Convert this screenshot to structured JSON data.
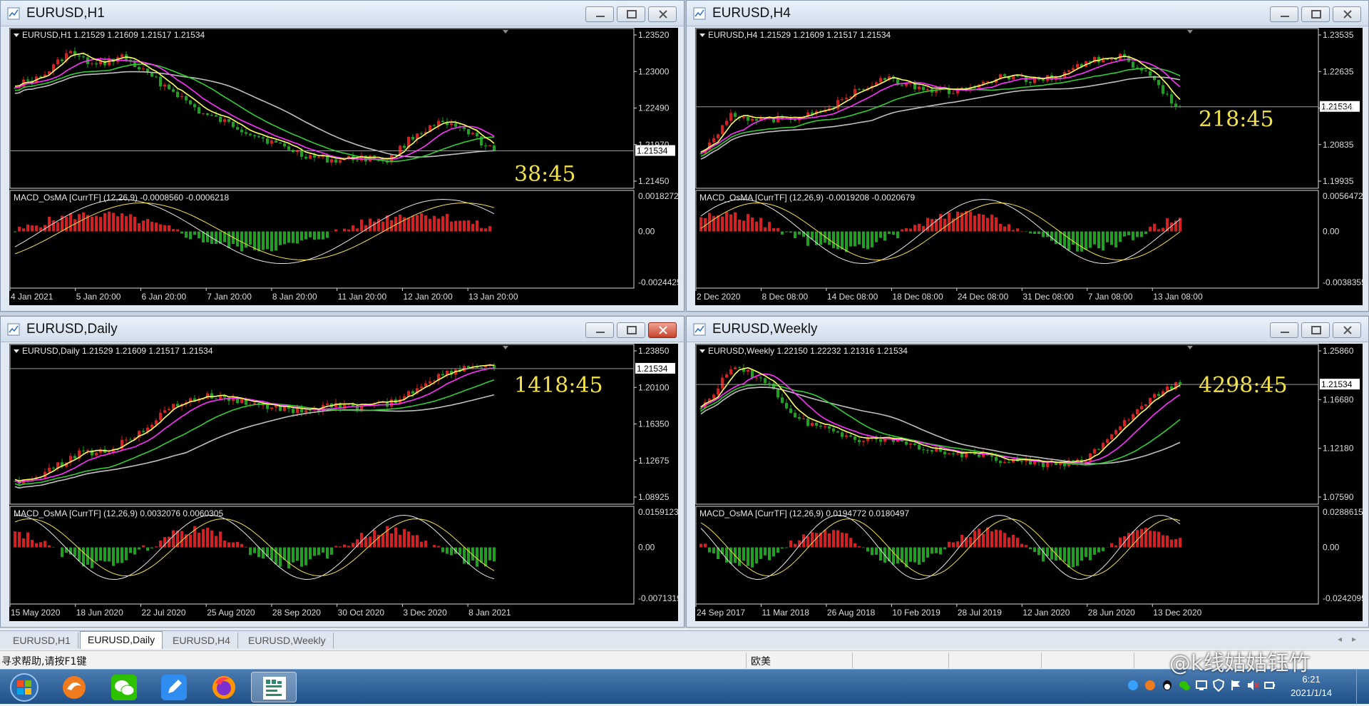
{
  "windows": [
    {
      "id": "h1",
      "title": "EURUSD,H1",
      "ohlc": "EURUSD,H1  1.21529 1.21609 1.21517 1.21534",
      "price_scale": [
        "1.23520",
        "1.23000",
        "1.22490",
        "1.21970",
        "1.21534",
        "1.21450"
      ],
      "current_price": "1.21534",
      "timer": "38:45",
      "macd_label": "MACD_OsMA [CurrTF] (12,26,9) -0.0008560 -0.0006218",
      "macd_scale": [
        "0.0018272",
        "0.00",
        "-0.0024425"
      ],
      "dates": [
        "4 Jan 2021",
        "5 Jan 20:00",
        "6 Jan 20:00",
        "7 Jan 20:00",
        "8 Jan 20:00",
        "11 Jan 20:00",
        "12 Jan 20:00",
        "13 Jan 20:00"
      ],
      "buttons": {
        "close_style": "normal"
      }
    },
    {
      "id": "h4",
      "title": "EURUSD,H4",
      "ohlc": "EURUSD,H4  1.21529 1.21609 1.21517 1.21534",
      "price_scale": [
        "1.23535",
        "1.22635",
        "1.21735",
        "1.21534",
        "1.20835",
        "1.19935"
      ],
      "current_price": "1.21534",
      "timer": "218:45",
      "macd_label": "MACD_OsMA [CurrTF] (12,26,9) -0.0019208 -0.0020679",
      "macd_scale": [
        "0.0056472",
        "0.00",
        "-0.0038355"
      ],
      "dates": [
        "2 Dec 2020",
        "8 Dec 08:00",
        "14 Dec 08:00",
        "18 Dec 08:00",
        "24 Dec 08:00",
        "31 Dec 08:00",
        "7 Jan 08:00",
        "13 Jan 08:00"
      ],
      "buttons": {
        "close_style": "normal"
      }
    },
    {
      "id": "daily",
      "title": "EURUSD,Daily",
      "ohlc": "EURUSD,Daily  1.21529 1.21609 1.21517 1.21534",
      "price_scale": [
        "1.23850",
        "1.21534",
        "1.20100",
        "1.16350",
        "1.12675",
        "1.08925"
      ],
      "current_price": "1.21534",
      "timer": "1418:45",
      "macd_label": "MACD_OsMA [CurrTF] (12,26,9) 0.0032076 0.0060305",
      "macd_scale": [
        "0.0159123",
        "0.00",
        "-0.0071319"
      ],
      "dates": [
        "15 May 2020",
        "18 Jun 2020",
        "22 Jul 2020",
        "25 Aug 2020",
        "28 Sep 2020",
        "30 Oct 2020",
        "3 Dec 2020",
        "8 Jan 2021"
      ],
      "buttons": {
        "close_style": "red"
      }
    },
    {
      "id": "weekly",
      "title": "EURUSD,Weekly",
      "ohlc": "EURUSD,Weekly  1.22150 1.22232 1.21316 1.21534",
      "price_scale": [
        "1.25860",
        "1.21534",
        "1.16680",
        "1.12180",
        "1.07590"
      ],
      "current_price": "1.21534",
      "timer": "4298:45",
      "macd_label": "MACD_OsMA [CurrTF] (12,26,9) 0.0194772 0.0180497",
      "macd_scale": [
        "0.0288615",
        "0.00",
        "-0.0242095"
      ],
      "dates": [
        "24 Sep 2017",
        "11 Mar 2018",
        "26 Aug 2018",
        "10 Feb 2019",
        "28 Jul 2019",
        "12 Jan 2020",
        "28 Jun 2020",
        "13 Dec 2020"
      ],
      "buttons": {
        "close_style": "normal"
      }
    }
  ],
  "tabs": [
    {
      "label": "EURUSD,H1",
      "active": false
    },
    {
      "label": "EURUSD,Daily",
      "active": true
    },
    {
      "label": "EURUSD,H4",
      "active": false
    },
    {
      "label": "EURUSD,Weekly",
      "active": false
    }
  ],
  "statusbar": {
    "help": "寻求帮助,请按F1键",
    "region": "欧美"
  },
  "clock": {
    "time": "6:21",
    "date": "2021/1/14"
  },
  "watermark": "@k线姑姑钰竹",
  "colors": {
    "bull": "#d42020",
    "bear": "#20a020",
    "ma_fast": "#ffff66",
    "ma_mid": "#ff33ff",
    "ma_slow": "#33cc33",
    "ma_long": "#c0c0c0",
    "timer": "#f2e14a"
  },
  "icons": {
    "start": "windows-start-orb-icon",
    "task1": "swirl-app-icon",
    "task2": "wechat-icon",
    "task3": "pen-note-icon",
    "task4": "firefox-icon",
    "task5": "mt4-terminal-icon"
  }
}
